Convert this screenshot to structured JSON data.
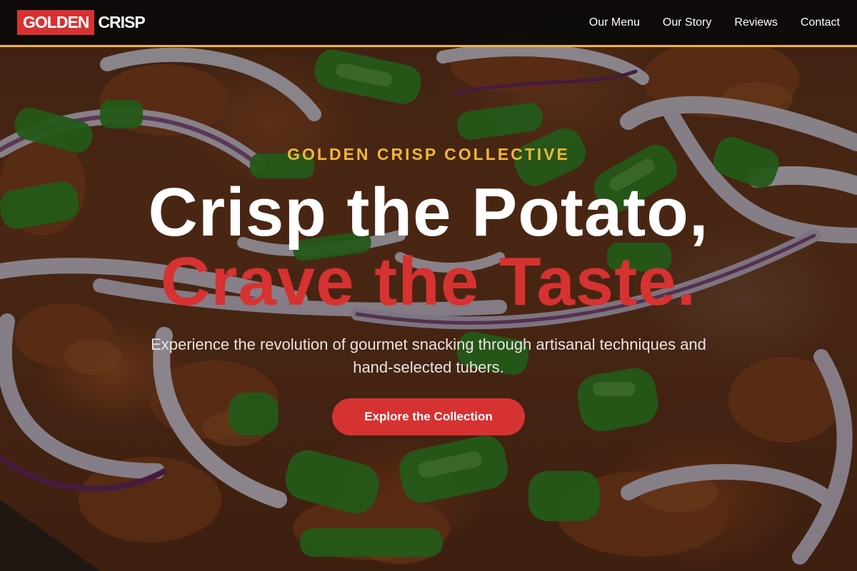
{
  "brand": {
    "logo_part_1": "GOLDEN",
    "logo_part_2": "CRISP"
  },
  "nav": {
    "items": [
      {
        "label": "Our Menu"
      },
      {
        "label": "Our Story"
      },
      {
        "label": "Reviews"
      },
      {
        "label": "Contact"
      }
    ]
  },
  "hero": {
    "eyebrow": "GOLDEN CRISP COLLECTIVE",
    "headline_line_1": "Crisp the Potato,",
    "headline_line_2": "Crave the Taste.",
    "subtitle": "Experience the revolution of gourmet snacking through artisanal techniques and hand-selected tubers.",
    "cta_label": "Explore the Collection",
    "background_image": "food-photo-red-onion-green-onion"
  },
  "colors": {
    "accent_red": "#d63232",
    "accent_gold": "#f2b53d",
    "header_bg": "#0a0a0a",
    "text_white": "#ffffff"
  }
}
